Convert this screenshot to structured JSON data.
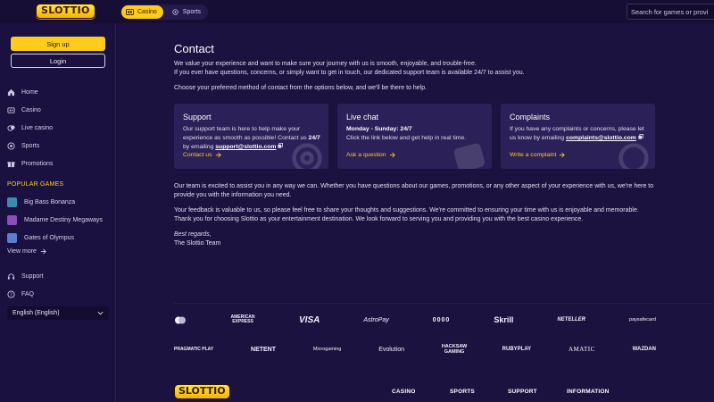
{
  "brand": {
    "logo_text": "SLOTTIO",
    "accent": "#ffcc1a",
    "bg": "#1c1240",
    "card_bg": "#2b2058"
  },
  "topbar": {
    "tabs": [
      {
        "label": "Casino",
        "icon": "casino-icon",
        "active": true
      },
      {
        "label": "Sports",
        "icon": "sports-ball-icon",
        "active": false
      }
    ],
    "search": {
      "placeholder": "Search for games or provi"
    }
  },
  "sidebar": {
    "signup_label": "Sign up",
    "login_label": "Login",
    "nav": [
      {
        "label": "Home",
        "icon": "home-icon"
      },
      {
        "label": "Casino",
        "icon": "casino-icon"
      },
      {
        "label": "Live casino",
        "icon": "live-casino-icon"
      },
      {
        "label": "Sports",
        "icon": "sports-ball-icon"
      },
      {
        "label": "Promotions",
        "icon": "promotions-icon"
      }
    ],
    "popular_title": "POPULAR GAMES",
    "games": [
      {
        "label": "Big Bass Bonanza"
      },
      {
        "label": "Madame Destiny Megaways"
      },
      {
        "label": "Gates of Olympus"
      }
    ],
    "view_more": "View more",
    "support": [
      {
        "label": "Support",
        "icon": "support-icon"
      },
      {
        "label": "FAQ",
        "icon": "faq-icon"
      }
    ],
    "language": "English (English)"
  },
  "main": {
    "title": "Contact",
    "intro1": "We value your experience and want to make sure your journey with us is smooth, enjoyable, and trouble-free.",
    "intro2": "If you ever have questions, concerns, or simply want to get in touch, our dedicated support team is available 24/7 to assist you.",
    "intro3": "Choose your preferred method of contact from the options below, and we'll be there to help.",
    "cards": [
      {
        "title": "Support",
        "text_a": "Our support team is here to help make your experience as smooth as possible! Contact us ",
        "text_bold": "24/7",
        "text_b": " by emailing ",
        "email": "support@slottio.com",
        "link": "Contact us"
      },
      {
        "title": "Live chat",
        "hours": "Monday - Sunday: 24/7",
        "text": "Click the link below and get help in real time.",
        "link": "Ask a question"
      },
      {
        "title": "Complaints",
        "text": "If you have any complaints or concerns, please let us know by emailing ",
        "email": "complaints@slottio.com",
        "link": "Write a complaint"
      }
    ],
    "para1": "Our team is excited to assist you in any way we can. Whether you have questions about our games, promotions, or any other aspect of your experience with us, we're here to provide you with the information you need.",
    "para2": "Your feedback is valuable to us, so please feel free to share your thoughts and suggestions. We're committed to ensuring your time with us is enjoyable and memorable.",
    "para3": "Thank you for choosing Slottio as your entertainment destination. We look forward to serving you and providing you with the best casino experience.",
    "regards": "Best regards,",
    "team": "The Slottio Team"
  },
  "payments": {
    "row1": [
      "mastercard",
      "AMERICAN EXPRESS",
      "VISA",
      "AstroPay",
      "0000",
      "Skrill",
      "NETELLER",
      "paysafecard"
    ],
    "row2": [
      "PRAGMATIC PLAY",
      "NETENT",
      "Microgaming",
      "Evolution",
      "HACKSAW GAMING",
      "RUBYPLAY",
      "AMATIC",
      "WAZDAN"
    ]
  },
  "footer": {
    "logo_text": "SLOTTIO",
    "cols": [
      "CASINO",
      "SPORTS",
      "SUPPORT",
      "INFORMATION"
    ]
  }
}
